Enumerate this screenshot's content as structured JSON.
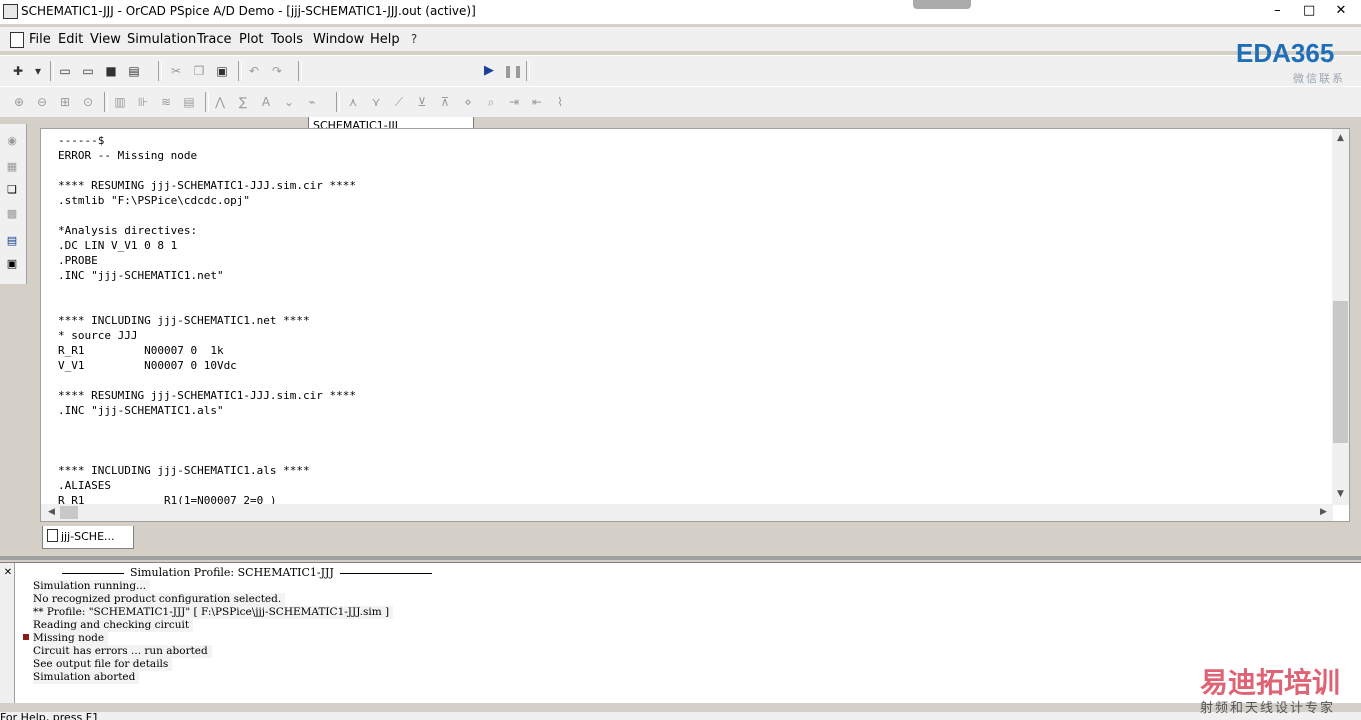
{
  "window": {
    "title": "SCHEMATIC1-JJJ - OrCAD PSpice A/D Demo  - [jjj-SCHEMATIC1-JJJ.out (active)]",
    "controls": [
      "–",
      "□",
      "✕"
    ]
  },
  "menu": [
    "File",
    "Edit",
    "View",
    "Simulation",
    "Trace",
    "Plot",
    "Tools",
    "Window",
    "Help"
  ],
  "toolbar": {
    "profile_value": "SCHEMATIC1-JJJ",
    "run_icon": "play-icon",
    "pause_icon": "pause-icon"
  },
  "document": {
    "lines": [
      "------$",
      "ERROR -- Missing node",
      "",
      "**** RESUMING jjj-SCHEMATIC1-JJJ.sim.cir ****",
      ".stmlib \"F:\\PSPice\\cdcdc.opj\"",
      "",
      "*Analysis directives:",
      ".DC LIN V_V1 0 8 1",
      ".PROBE",
      ".INC \"jjj-SCHEMATIC1.net\"",
      "",
      "",
      "**** INCLUDING jjj-SCHEMATIC1.net ****",
      "* source JJJ",
      "R_R1         N00007 0  1k",
      "V_V1         N00007 0 10Vdc",
      "",
      "**** RESUMING jjj-SCHEMATIC1-JJJ.sim.cir ****",
      ".INC \"jjj-SCHEMATIC1.als\"",
      "",
      "",
      "",
      "**** INCLUDING jjj-SCHEMATIC1.als ****",
      ".ALIASES",
      "R_R1            R1(1=N00007 2=0 )"
    ],
    "tab_label": "jjj-SCHE..."
  },
  "output": {
    "header": "Simulation Profile:  SCHEMATIC1-JJJ",
    "lines": [
      "Simulation running...",
      "No recognized product configuration selected.",
      "** Profile: \"SCHEMATIC1-JJJ\"  [ F:\\PSPice\\jjj-SCHEMATIC1-JJJ.sim ]",
      "Reading and checking circuit",
      "Missing node",
      "Circuit has errors ... run aborted",
      "See output file for details",
      "Simulation aborted"
    ]
  },
  "status": {
    "text": "For Help, press F1"
  },
  "watermarks": {
    "top_brand": "EDA365",
    "top_sub": "微信联系",
    "bottom_brand": "易迪拓培训",
    "bottom_sub": "射频和天线设计专家"
  }
}
